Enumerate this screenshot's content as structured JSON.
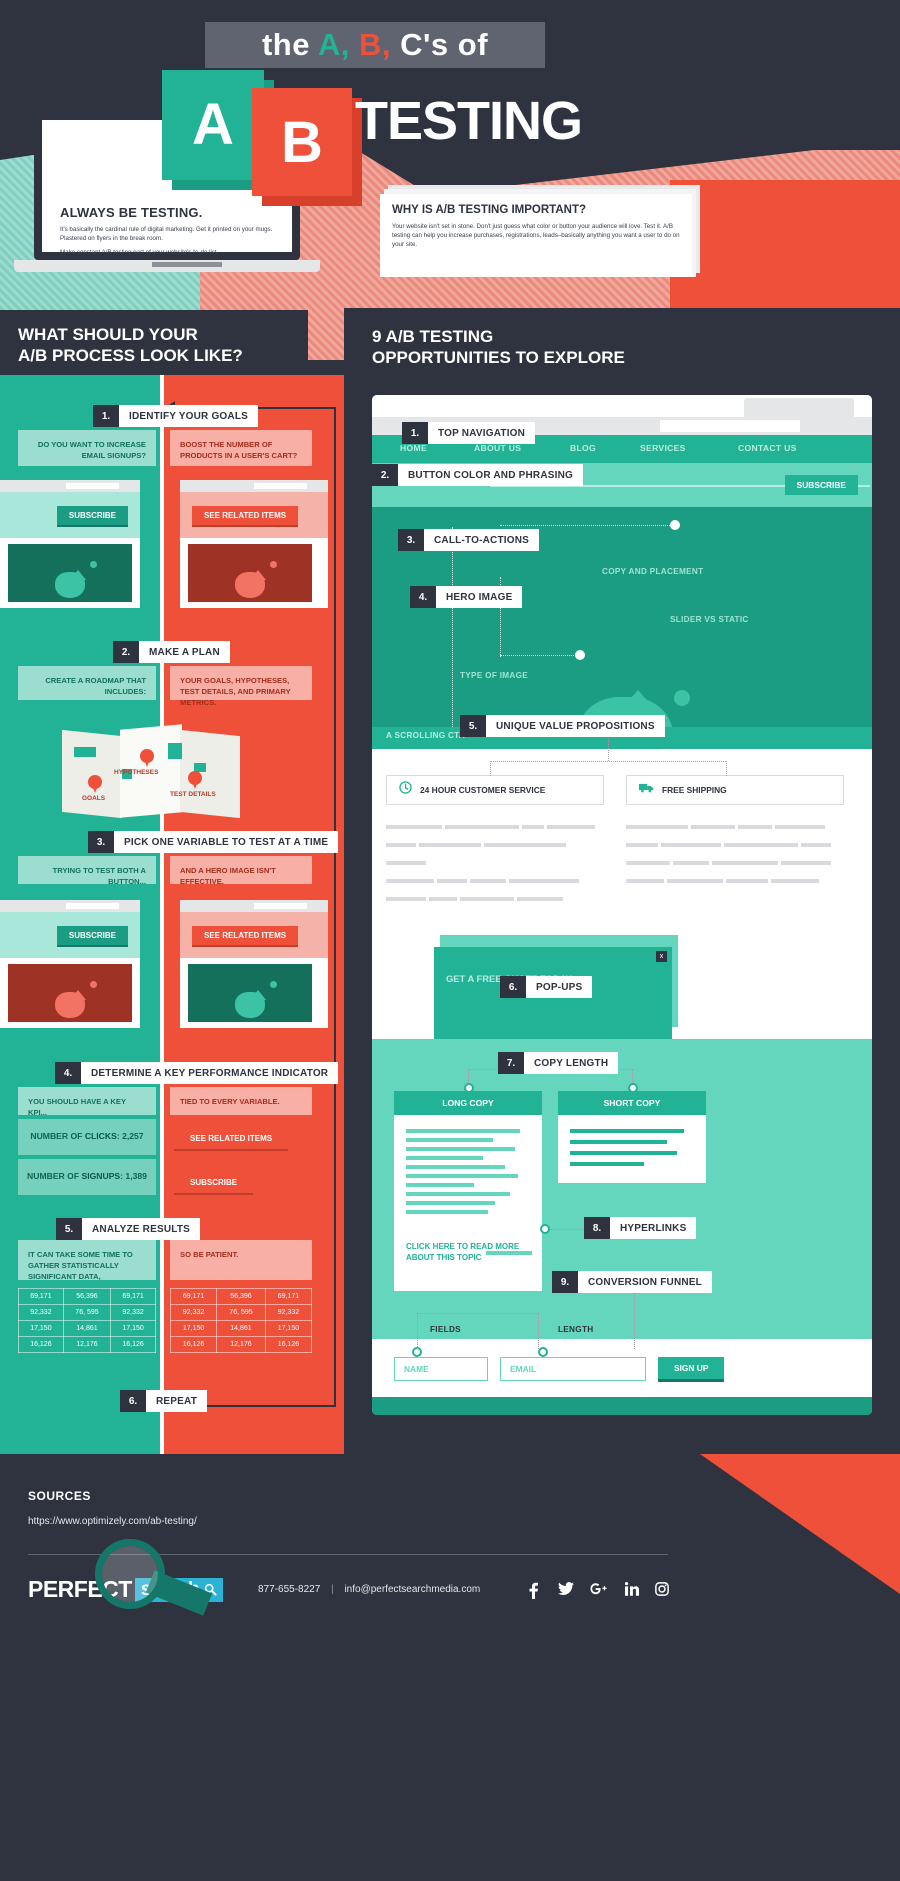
{
  "header": {
    "kicker_the": "the",
    "kicker_a": "A,",
    "kicker_b": "B,",
    "kicker_cs": "C's of",
    "letter_a": "A",
    "letter_b": "B",
    "title": "TESTING",
    "laptop_card": {
      "heading": "ALWAYS BE TESTING.",
      "body1": "It's basically the cardinal rule of digital marketing. Get it printed on your mugs. Plastered on flyers in the break room.",
      "body2": "Make constant A/B testing part of your website's to-do list."
    },
    "why_card": {
      "heading": "WHY IS A/B TESTING IMPORTANT?",
      "body": "Your website isn't set in stone. Don't just guess what color or button your audience will love. Test it. A/B testing can help you increase purchases, registrations, leads–basically anything you want a user to do on your site."
    }
  },
  "left_column": {
    "title_line1": "WHAT SHOULD YOUR",
    "title_line2": "A/B PROCESS LOOK LIKE?",
    "steps": [
      {
        "num": "1.",
        "label": "IDENTIFY YOUR GOALS",
        "left_bubble": "DO YOU WANT TO INCREASE EMAIL SIGNUPS?",
        "right_bubble": "BOOST THE NUMBER OF PRODUCTS IN A USER'S CART?"
      },
      {
        "num": "2.",
        "label": "MAKE A PLAN",
        "left_bubble": "CREATE A ROADMAP THAT INCLUDES:",
        "right_bubble": "YOUR GOALS, HYPOTHESES, TEST DETAILS, AND PRIMARY METRICS."
      },
      {
        "num": "3.",
        "label": "PICK ONE VARIABLE TO TEST AT A TIME",
        "left_bubble": "TRYING TO TEST BOTH A BUTTON...",
        "right_bubble": "AND A HERO IMAGE ISN'T EFFECTIVE."
      },
      {
        "num": "4.",
        "label": "DETERMINE A KEY PERFORMANCE INDICATOR",
        "left_bubble": "YOU SHOULD HAVE A KEY KPI...",
        "right_bubble": "TIED TO EVERY VARIABLE."
      },
      {
        "num": "5.",
        "label": "ANALYZE RESULTS",
        "left_bubble": "IT CAN TAKE SOME TIME TO GATHER STATISTICALLY SIGNIFICANT DATA,",
        "right_bubble": "SO BE PATIENT."
      },
      {
        "num": "6.",
        "label": "REPEAT",
        "left_bubble": "",
        "right_bubble": ""
      }
    ],
    "buttons": {
      "subscribe": "SUBSCRIBE",
      "see_related": "SEE RELATED ITEMS"
    },
    "map_labels": {
      "hypotheses": "HYPOTHESES",
      "goals": "GOALS",
      "test_details": "TEST DETAILS"
    },
    "kpi": {
      "clicks_label": "NUMBER OF ",
      "clicks_strong": "CLICKS",
      "clicks_value": ": 2,257",
      "signups_label": "NUMBER OF ",
      "signups_strong": "SIGNUPS",
      "signups_value": ": 1,389"
    },
    "results_table": {
      "rows": [
        [
          "69,171",
          "56,396",
          "69,171"
        ],
        [
          "92,332",
          "76, 595",
          "92,332"
        ],
        [
          "17,150",
          "14,861",
          "17,150"
        ],
        [
          "16,126",
          "12,176",
          "16,126"
        ]
      ]
    }
  },
  "right_column": {
    "title_line1": "9 A/B TESTING",
    "title_line2": "OPPORTUNITIES TO EXPLORE",
    "nav": [
      "HOME",
      "ABOUT US",
      "BLOG",
      "SERVICES",
      "CONTACT US"
    ],
    "subscribe_button": "SUBSCRIBE",
    "steps": [
      {
        "num": "1.",
        "label": "TOP NAVIGATION"
      },
      {
        "num": "2.",
        "label": "BUTTON COLOR AND PHRASING"
      },
      {
        "num": "3.",
        "label": "CALL-TO-ACTIONS"
      },
      {
        "num": "4.",
        "label": "HERO IMAGE"
      },
      {
        "num": "5.",
        "label": "UNIQUE VALUE PROPOSITIONS"
      },
      {
        "num": "6.",
        "label": "POP-UPS"
      },
      {
        "num": "7.",
        "label": "COPY LENGTH"
      },
      {
        "num": "8.",
        "label": "HYPERLINKS"
      },
      {
        "num": "9.",
        "label": "CONVERSION FUNNEL"
      }
    ],
    "annotations": {
      "copy_and_placement": "COPY AND PLACEMENT",
      "slider_vs_static": "SLIDER VS STATIC",
      "type_of_image": "TYPE OF IMAGE",
      "scrolling_cta": "A SCROLLING CTA",
      "fields": "FIELDS",
      "length": "LENGTH"
    },
    "value_props": [
      {
        "icon": "clock-icon",
        "text": "24 HOUR CUSTOMER SERVICE"
      },
      {
        "icon": "truck-icon",
        "text": "FREE SHIPPING"
      }
    ],
    "popup": {
      "heading": "GET A FREE QUOTE TODAY",
      "close": "x"
    },
    "copy_cards": {
      "long": "LONG COPY",
      "short": "SHORT COPY"
    },
    "click_here": "CLICK HERE TO READ MORE ABOUT THIS TOPIC",
    "form": {
      "name_placeholder": "NAME",
      "email_placeholder": "EMAIL",
      "submit": "SIGN UP"
    }
  },
  "footer": {
    "sources_heading": "SOURCES",
    "source_url": "https://www.optimizely.com/ab-testing/",
    "logo_perfect": "PERFECT",
    "logo_search": "search",
    "phone": "877-655-8227",
    "divider": "|",
    "email": "info@perfectsearchmedia.com",
    "social": [
      "f",
      "t",
      "g+",
      "in",
      "ig"
    ]
  },
  "colors": {
    "teal": "#22b396",
    "red": "#ef503a",
    "dark": "#2e333f",
    "light_teal": "#63d6bd"
  }
}
